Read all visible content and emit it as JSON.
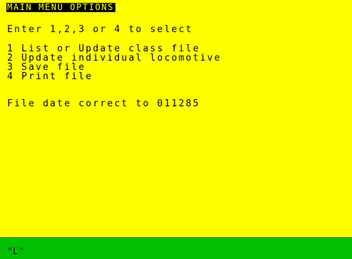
{
  "menu": {
    "title": "MAIN MENU OPTIONS",
    "prompt": "Enter 1,2,3 or 4 to select",
    "options": [
      "1 List or Update class file",
      "2 Update individual locomotive",
      "3 Save file",
      "4 Print file"
    ],
    "file_date": "File date correct to 011285"
  },
  "status": {
    "input_mode": "\"L\""
  },
  "colors": {
    "paper": "#ffff00",
    "ink": "#000000",
    "status_bar": "#00c000"
  }
}
